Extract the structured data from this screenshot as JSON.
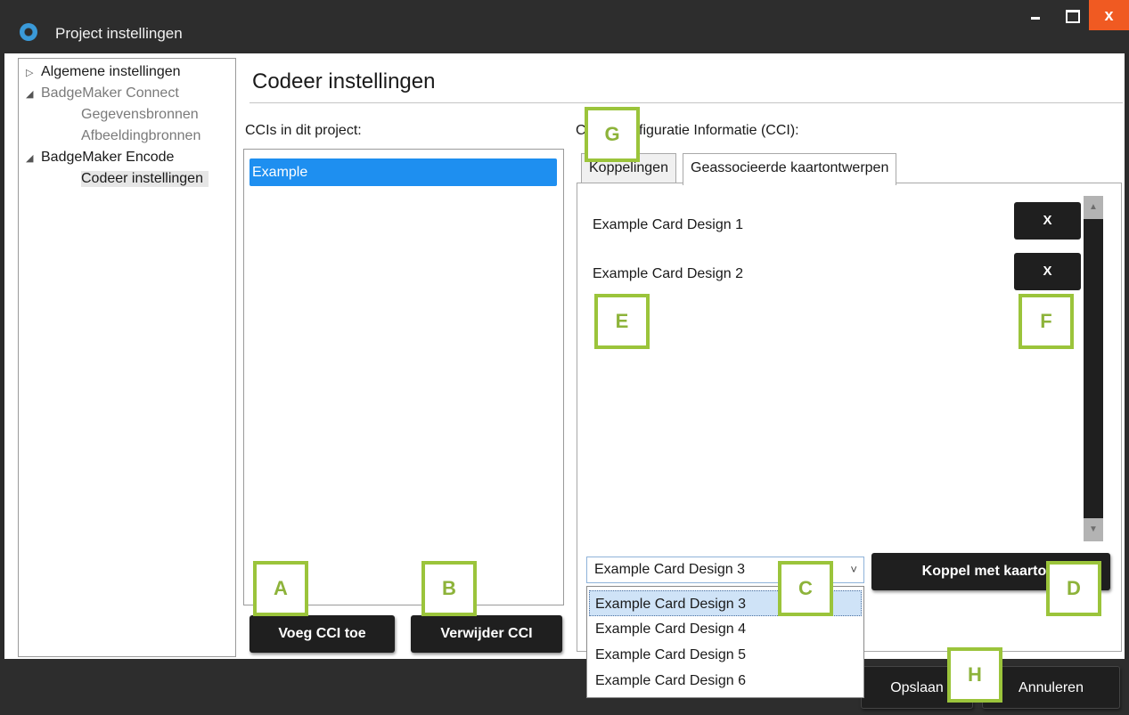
{
  "window": {
    "title": "Project instellingen",
    "close_glyph": "x",
    "accent": "#f05a22"
  },
  "tree": {
    "items": [
      {
        "label": "Algemene instellingen",
        "toggle": "▷"
      },
      {
        "label": "BadgeMaker Connect",
        "toggle": "◢"
      },
      {
        "label": "Gegevensbronnen"
      },
      {
        "label": "Afbeeldingbronnen"
      },
      {
        "label": "BadgeMaker Encode",
        "toggle": "◢"
      },
      {
        "label": "Codeer instellingen"
      }
    ]
  },
  "main": {
    "title": "Codeer instellingen",
    "ccis_label": "CCIs in dit project:",
    "cci_items": [
      "Example"
    ],
    "config_label_left": "C",
    "config_label_right": "figuratie Informatie (CCI):",
    "add_button": "Voeg CCI toe",
    "remove_button": "Verwijder CCI",
    "tabs": [
      {
        "label": "Koppelingen"
      },
      {
        "label": "Geassocieerde kaartontwerpen",
        "active": true
      }
    ],
    "associated": [
      {
        "name": "Example Card Design 1",
        "remove": "X"
      },
      {
        "name": "Example Card Design 2",
        "remove": "X"
      }
    ],
    "combo_value": "Example Card Design 3",
    "combo_arrow": "˅",
    "dropdown_options": [
      "Example Card Design 3",
      "Example Card Design 4",
      "Example Card Design 5",
      "Example Card Design 6"
    ],
    "link_button": "Koppel met kaartont"
  },
  "footer": {
    "save_button": "Opslaan",
    "cancel_button": "Annuleren"
  },
  "callouts": {
    "a": "A",
    "b": "B",
    "c": "C",
    "d": "D",
    "e": "E",
    "f": "F",
    "g": "G",
    "h": "H"
  },
  "colors": {
    "selection": "#1e8ff0",
    "callout": "#9bc43b",
    "button": "#1f1f1f"
  }
}
